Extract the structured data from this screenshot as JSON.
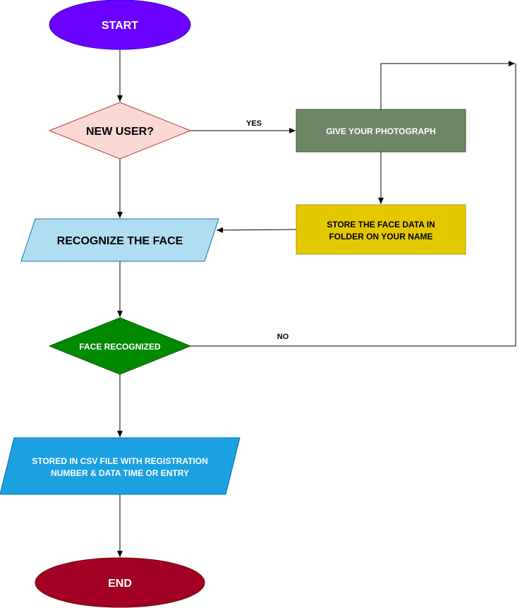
{
  "nodes": {
    "start": {
      "label": "START",
      "fill": "#6a00ff",
      "stroke": "#3700cc",
      "text_color": "#ffffff"
    },
    "new_user": {
      "label": "NEW USER?",
      "fill": "#fad9d5",
      "stroke": "#ae4132",
      "text_color": "#000000"
    },
    "give_photo": {
      "label": "GIVE YOUR PHOTOGRAPH",
      "fill": "#6d8764",
      "stroke": "#3a5431",
      "text_color": "#ffffff"
    },
    "store_face": {
      "label_line1": "STORE THE FACE DATA IN",
      "label_line2": "FOLDER ON YOUR NAME",
      "fill": "#e3c800",
      "stroke": "#b09500",
      "text_color": "#000000"
    },
    "recognize": {
      "label": "RECOGNIZE THE FACE",
      "fill": "#b1ddf0",
      "stroke": "#10739e",
      "text_color": "#000000"
    },
    "face_recognized": {
      "label": "FACE RECOGNIZED",
      "fill": "#008a00",
      "stroke": "#005700",
      "text_color": "#ffffff"
    },
    "stored_csv": {
      "label_line1": "STORED IN CSV FILE WITH REGISTRATION",
      "label_line2": "NUMBER & DATA TIME OR ENTRY",
      "fill": "#1ba1e2",
      "stroke": "#006eaf",
      "text_color": "#ffffff"
    },
    "end": {
      "label": "END",
      "fill": "#a20025",
      "stroke": "#6f0000",
      "text_color": "#ffffff"
    }
  },
  "edges": {
    "yes_label": "YES",
    "no_label": "NO"
  }
}
